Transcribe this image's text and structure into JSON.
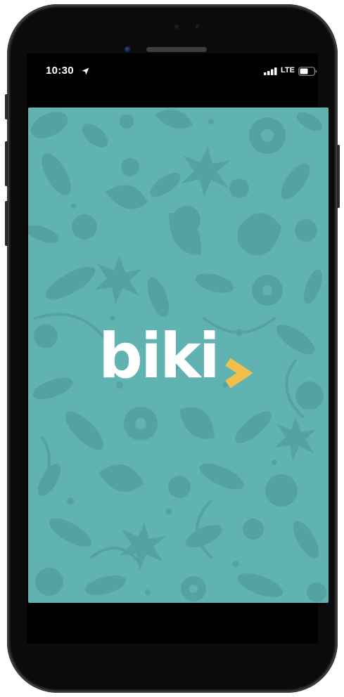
{
  "status_bar": {
    "time": "10:30",
    "carrier": "LTE",
    "icons": [
      "location-arrow-icon",
      "signal-bars-icon",
      "battery-icon"
    ]
  },
  "splash": {
    "logo_text": "biki",
    "logo_mark": "chevron-right-icon"
  },
  "colors": {
    "background": "#61b3b2",
    "pattern": "#54a3a2",
    "logo_text": "#ffffff",
    "logo_accent": "#f2c04a",
    "device": "#0b0b0b"
  }
}
